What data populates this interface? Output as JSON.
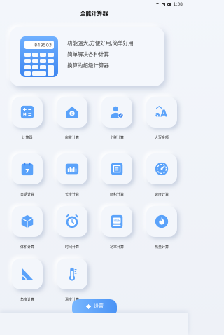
{
  "status": {
    "time": "1:38"
  },
  "title": "全能计算器",
  "banner": {
    "display_value": "849503",
    "lines": [
      "功能强大,方便好用,简单好用",
      "简单解决各种计算",
      "换算的超级计算器"
    ]
  },
  "tiles": [
    {
      "label": "计算器",
      "icon": "calculator-icon"
    },
    {
      "label": "房贷计算",
      "icon": "house-loan-icon"
    },
    {
      "label": "个税计算",
      "icon": "person-tax-icon"
    },
    {
      "label": "大写金额",
      "icon": "uppercase-amount-icon"
    },
    {
      "label": "日期计算",
      "icon": "calendar-icon"
    },
    {
      "label": "长度计算",
      "icon": "ruler-icon"
    },
    {
      "label": "面积计算",
      "icon": "area-icon"
    },
    {
      "label": "速度计算",
      "icon": "speedometer-icon"
    },
    {
      "label": "体积计算",
      "icon": "cube-icon"
    },
    {
      "label": "时间计算",
      "icon": "alarm-clock-icon"
    },
    {
      "label": "功率计算",
      "icon": "power-meter-icon"
    },
    {
      "label": "热量计算",
      "icon": "flame-icon"
    },
    {
      "label": "角度计算",
      "icon": "angle-icon"
    },
    {
      "label": "温度计算",
      "icon": "thermometer-icon"
    }
  ],
  "settings": {
    "label": "设置",
    "icon": "gear-icon"
  },
  "colors": {
    "accent": "#4a93f5",
    "accent_light": "#79b7ff"
  }
}
